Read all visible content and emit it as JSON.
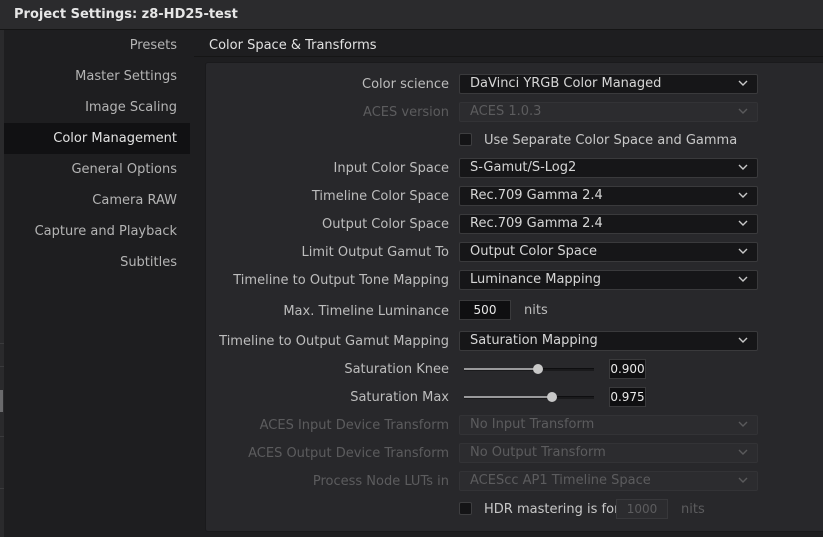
{
  "window": {
    "title": "Project Settings:  z8-HD25-test"
  },
  "sidebar": {
    "items": [
      {
        "label": "Presets",
        "active": false
      },
      {
        "label": "Master Settings",
        "active": false
      },
      {
        "label": "Image Scaling",
        "active": false
      },
      {
        "label": "Color Management",
        "active": true
      },
      {
        "label": "General Options",
        "active": false
      },
      {
        "label": "Camera RAW",
        "active": false
      },
      {
        "label": "Capture and Playback",
        "active": false
      },
      {
        "label": "Subtitles",
        "active": false
      }
    ]
  },
  "section": {
    "title": "Color Space & Transforms"
  },
  "fields": {
    "color_science": {
      "label": "Color science",
      "value": "DaVinci YRGB Color Managed",
      "enabled": true
    },
    "aces_version": {
      "label": "ACES version",
      "value": "ACES 1.0.3",
      "enabled": false
    },
    "separate_gamma": {
      "label": "Use Separate Color Space and Gamma",
      "checked": false
    },
    "input_color_space": {
      "label": "Input Color Space",
      "value": "S-Gamut/S-Log2",
      "enabled": true
    },
    "timeline_color_space": {
      "label": "Timeline Color Space",
      "value": "Rec.709 Gamma 2.4",
      "enabled": true
    },
    "output_color_space": {
      "label": "Output Color Space",
      "value": "Rec.709 Gamma 2.4",
      "enabled": true
    },
    "limit_output_gamut": {
      "label": "Limit Output Gamut To",
      "value": "Output Color Space",
      "enabled": true
    },
    "tone_mapping": {
      "label": "Timeline to Output Tone Mapping",
      "value": "Luminance Mapping",
      "enabled": true
    },
    "max_luminance": {
      "label": "Max. Timeline Luminance",
      "value": "500",
      "unit": "nits"
    },
    "gamut_mapping": {
      "label": "Timeline to Output Gamut Mapping",
      "value": "Saturation Mapping",
      "enabled": true
    },
    "saturation_knee": {
      "label": "Saturation Knee",
      "value": "0.900",
      "slider_fraction": 0.57
    },
    "saturation_max": {
      "label": "Saturation Max",
      "value": "0.975",
      "slider_fraction": 0.68
    },
    "aces_idt": {
      "label": "ACES Input Device Transform",
      "value": "No Input Transform",
      "enabled": false
    },
    "aces_odt": {
      "label": "ACES Output Device Transform",
      "value": "No Output Transform",
      "enabled": false
    },
    "process_node_luts": {
      "label": "Process Node LUTs in",
      "value": "ACEScc AP1 Timeline Space",
      "enabled": false
    },
    "hdr_mastering": {
      "label": "HDR mastering is for",
      "checked": false,
      "value": "1000",
      "unit": "nits"
    }
  },
  "icons": {
    "dropdown": "chevron-down-icon"
  }
}
